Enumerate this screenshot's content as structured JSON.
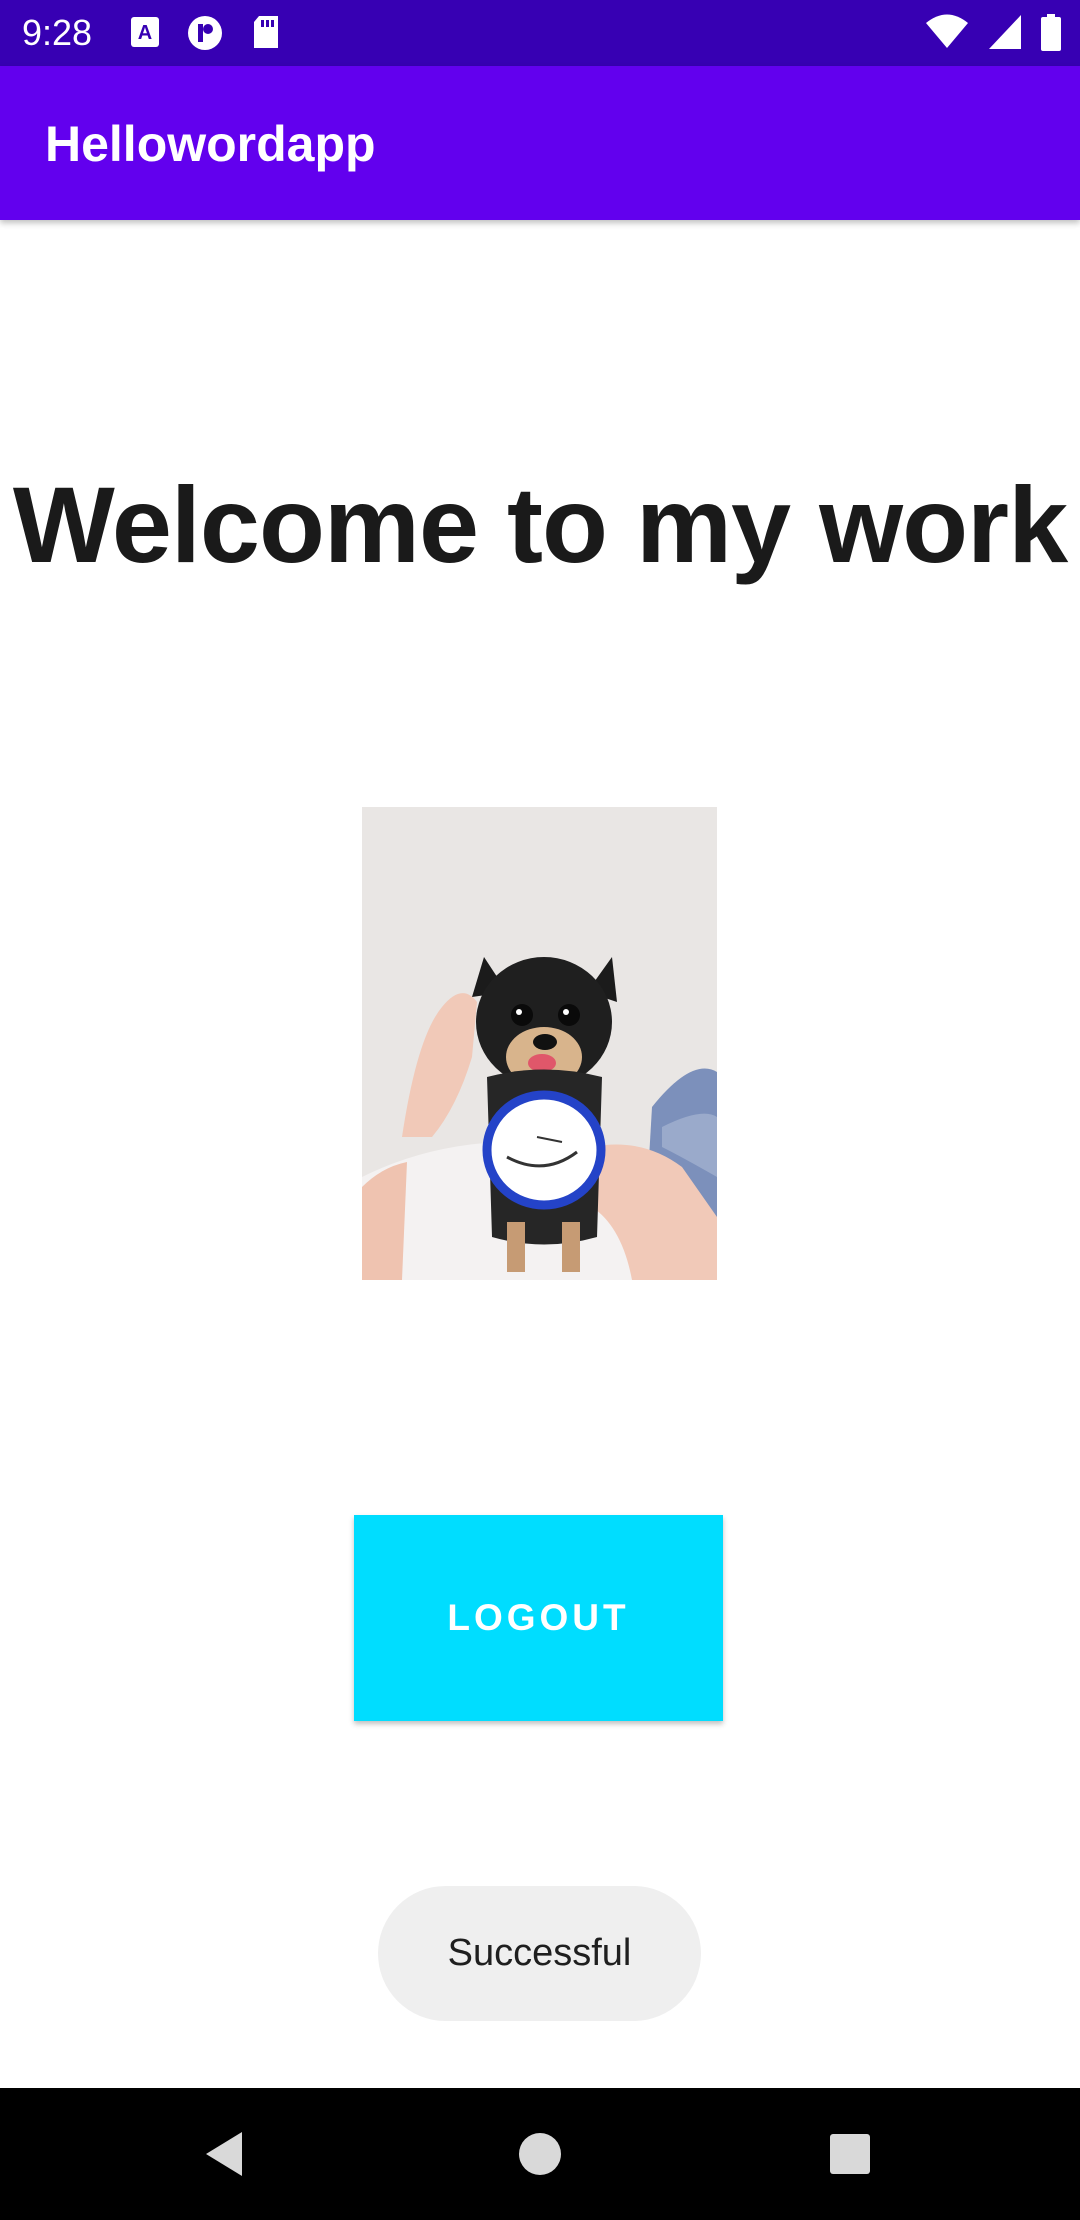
{
  "status_bar": {
    "time": "9:28",
    "left_icons": [
      "keyboard-a-icon",
      "notification-p-icon",
      "sd-card-icon"
    ],
    "right_icons": [
      "wifi-icon",
      "cell-signal-icon",
      "battery-icon"
    ]
  },
  "app_bar": {
    "title": "Hellowordapp",
    "color": "#6200ee"
  },
  "main": {
    "heading": "Welcome to my work",
    "photo_icon": "dog-photo",
    "logout_label": "LOGOUT",
    "logout_color": "#00ddff"
  },
  "toast": {
    "message": "Successful"
  },
  "nav_bar": {
    "buttons": [
      "back-icon",
      "home-icon",
      "recents-icon"
    ]
  }
}
